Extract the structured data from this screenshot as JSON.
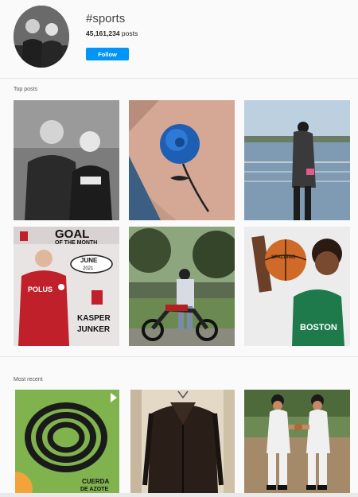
{
  "header": {
    "hashtag": "#sports",
    "posts_count": "45,161,234",
    "posts_suffix": "posts",
    "follow_label": "Follow"
  },
  "sections": {
    "top_posts_label": "Top posts",
    "most_recent_label": "Most recent"
  },
  "posts": {
    "goal_card": {
      "headline": "GOAL",
      "subheadline": "OF THE MONTH",
      "month": "JUNE",
      "year": "2021",
      "first_name": "KASPER",
      "last_name": "JUNKER",
      "jersey_text": "POLUS"
    },
    "basketball": {
      "ball_text": "SPALDING",
      "jersey_text": "BOSTON"
    },
    "rope": {
      "caption_line1": "CUERDA",
      "caption_line2": "DE AZOTE"
    }
  },
  "colors": {
    "accent": "#0095f6",
    "background": "#fafafa"
  }
}
